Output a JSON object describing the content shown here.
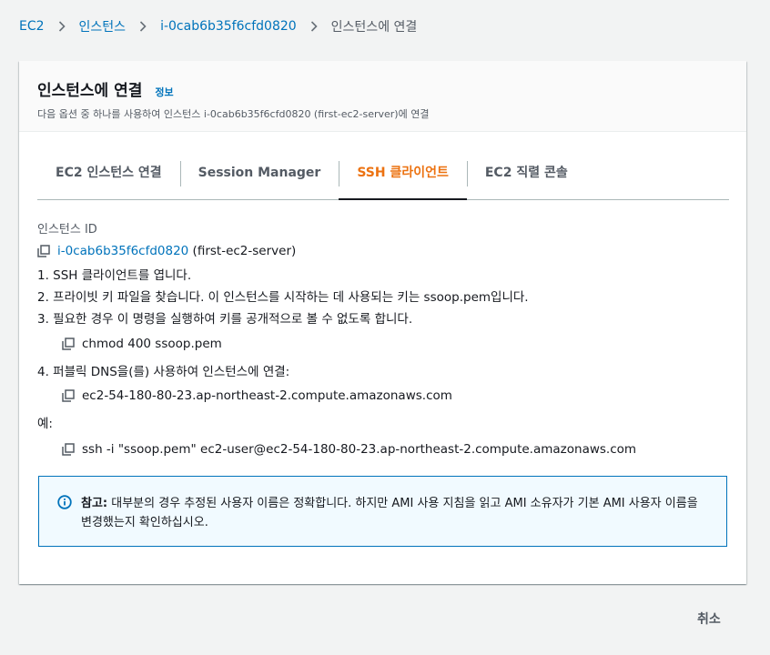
{
  "breadcrumb": {
    "items": [
      "EC2",
      "인스턴스",
      "i-0cab6b35f6cfd0820"
    ],
    "current": "인스턴스에 연결"
  },
  "header": {
    "title": "인스턴스에 연결",
    "info": "정보",
    "description": "다음 옵션 중 하나를 사용하여 인스턴스 i-0cab6b35f6cfd0820 (first-ec2-server)에 연결"
  },
  "tabs": [
    "EC2 인스턴스 연결",
    "Session Manager",
    "SSH 클라이언트",
    "EC2 직렬 콘솔"
  ],
  "active_tab": "SSH 클라이언트",
  "content": {
    "instance_id_label": "인스턴스 ID",
    "instance_id": "i-0cab6b35f6cfd0820",
    "instance_name": " (first-ec2-server)",
    "step1": "1. SSH 클라이언트를 엽니다.",
    "step2": "2. 프라이빗 키 파일을 찾습니다. 이 인스턴스를 시작하는 데 사용되는 키는 ssoop.pem입니다.",
    "step3": "3. 필요한 경우 이 명령을 실행하여 키를 공개적으로 볼 수 없도록 합니다.",
    "cmd_chmod": "chmod 400 ssoop.pem",
    "step4": "4. 퍼블릭 DNS을(를) 사용하여 인스턴스에 연결:",
    "dns": "ec2-54-180-80-23.ap-northeast-2.compute.amazonaws.com",
    "example_label": "예:",
    "ssh_cmd": "ssh -i \"ssoop.pem\" ec2-user@ec2-54-180-80-23.ap-northeast-2.compute.amazonaws.com"
  },
  "alert": {
    "icon": "info-circle-icon",
    "bold": "참고:",
    "text": " 대부분의 경우 추정된 사용자 이름은 정확합니다. 하지만 AMI 사용 지침을 읽고 AMI 소유자가 기본 AMI 사용자 이름을 변경했는지 확인하십시오."
  },
  "footer": {
    "cancel": "취소"
  },
  "colors": {
    "link": "#0073bb",
    "active_tab": "#ec7211",
    "alert_bg": "#f1faff",
    "alert_border": "#0073bb"
  }
}
